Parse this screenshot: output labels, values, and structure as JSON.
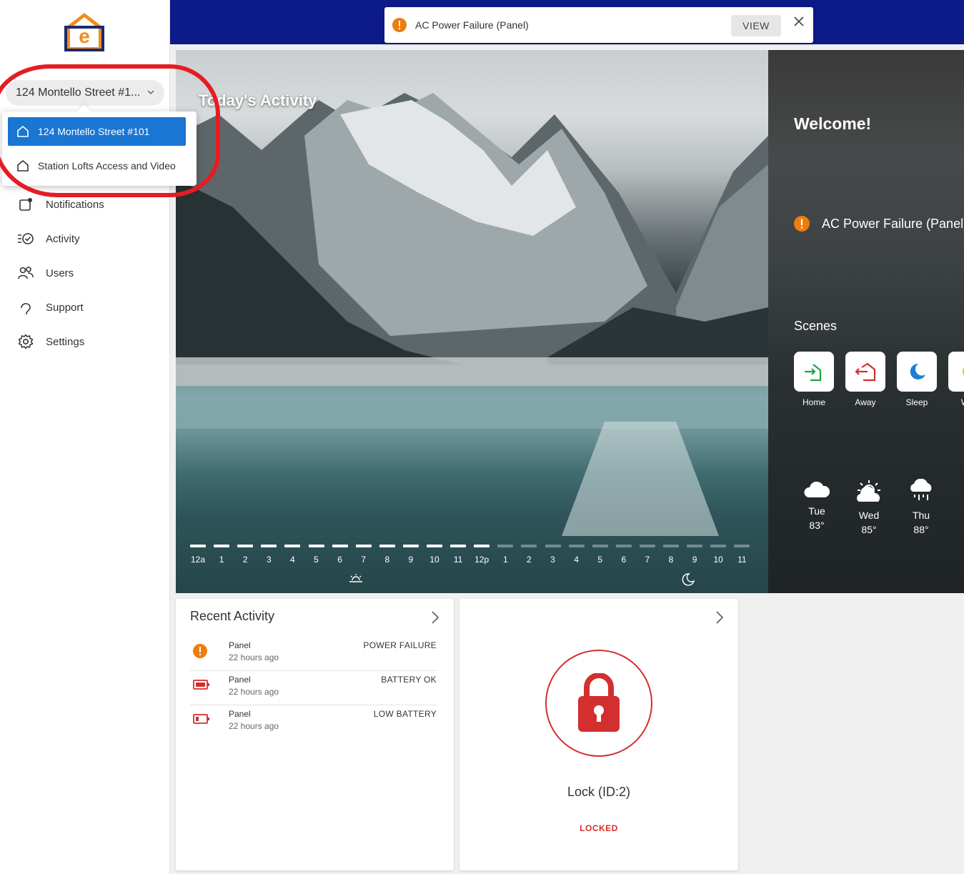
{
  "location_selector": {
    "current": "124 Montello Street #1...",
    "options": [
      {
        "label": "124 Montello Street #101",
        "selected": true
      },
      {
        "label": "Station Lofts Access and Video",
        "selected": false
      }
    ]
  },
  "nav": [
    {
      "label": "Notifications",
      "icon": "notifications-icon"
    },
    {
      "label": "Activity",
      "icon": "activity-icon"
    },
    {
      "label": "Users",
      "icon": "users-icon"
    },
    {
      "label": "Support",
      "icon": "support-icon"
    },
    {
      "label": "Settings",
      "icon": "gear-icon"
    }
  ],
  "toast": {
    "message": "AC Power Failure (Panel)",
    "view_label": "VIEW"
  },
  "hero": {
    "title": "Today's Activity",
    "timeline_labels": [
      "12a",
      "1",
      "2",
      "3",
      "4",
      "5",
      "6",
      "7",
      "8",
      "9",
      "10",
      "11",
      "12p",
      "1",
      "2",
      "3",
      "4",
      "5",
      "6",
      "7",
      "8",
      "9",
      "10",
      "11"
    ],
    "elapsed_hours": 13
  },
  "right_panel": {
    "welcome": "Welcome!",
    "alert": "AC Power Failure (Panel)",
    "scenes_label": "Scenes",
    "scenes": [
      {
        "label": "Home",
        "icon": "home-arrive-icon",
        "color": "#1ea34a"
      },
      {
        "label": "Away",
        "icon": "away-leave-icon",
        "color": "#d32f2f"
      },
      {
        "label": "Sleep",
        "icon": "moon-icon",
        "color": "#1e7fd6"
      },
      {
        "label": "Wal",
        "icon": "wake-icon",
        "color": "#f2c500"
      }
    ],
    "weather": [
      {
        "day": "Tue",
        "temp": "83°",
        "icon": "cloud-icon"
      },
      {
        "day": "Wed",
        "temp": "85°",
        "icon": "partly-sunny-icon"
      },
      {
        "day": "Thu",
        "temp": "88°",
        "icon": "rain-icon"
      }
    ]
  },
  "recent_activity": {
    "title": "Recent Activity",
    "items": [
      {
        "name": "Panel",
        "time": "22 hours ago",
        "status": "POWER FAILURE",
        "icon": "warning-icon"
      },
      {
        "name": "Panel",
        "time": "22 hours ago",
        "status": "BATTERY OK",
        "icon": "battery-full-icon"
      },
      {
        "name": "Panel",
        "time": "22 hours ago",
        "status": "LOW BATTERY",
        "icon": "battery-low-icon"
      }
    ]
  },
  "lock_card": {
    "name": "Lock (ID:2)",
    "status": "LOCKED"
  },
  "colors": {
    "topbar": "#0c1a8a",
    "accent": "#1976d2",
    "warning": "#ee7d0e",
    "danger": "#d32f2f"
  }
}
